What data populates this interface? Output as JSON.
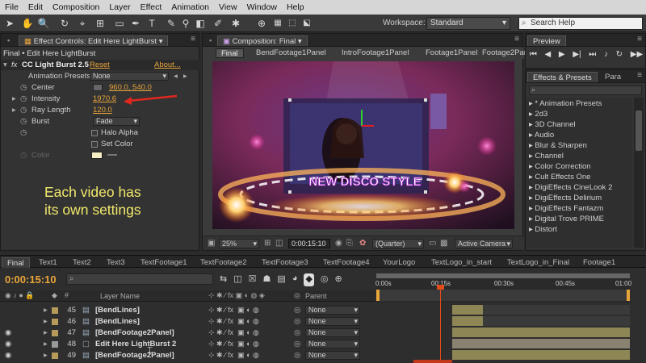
{
  "menu": [
    "File",
    "Edit",
    "Composition",
    "Layer",
    "Effect",
    "Animation",
    "View",
    "Window",
    "Help"
  ],
  "workspace": {
    "label": "Workspace:",
    "value": "Standard",
    "search_placeholder": "Search Help"
  },
  "effect_controls": {
    "tab_label": "Effect Controls: Edit Here LightBurst",
    "breadcrumb": "Final • Edit Here LightBurst",
    "effect_name": "CC Light Burst 2.5",
    "reset": "Reset",
    "about": "About...",
    "presets_label": "Animation Presets:",
    "presets_value": "None",
    "center_label": "Center",
    "center_value": "960.0, 540.0",
    "intensity_label": "Intensity",
    "intensity_value": "1970.6",
    "ray_label": "Ray Length",
    "ray_value": "120.0",
    "burst_label": "Burst",
    "burst_value": "Fade",
    "halo_label": "Halo Alpha",
    "setcolor_label": "Set Color",
    "color_label": "Color",
    "caption_line1": "Each video has",
    "caption_line2": "its own settings"
  },
  "composition": {
    "tab_label": "Composition: Final",
    "subtabs": [
      "Final",
      "BendFootage1Panel",
      "IntroFootage1Panel",
      "Footage1Panel",
      "Footage2Panel"
    ],
    "zoom": "25%",
    "timecode": "0:00:15:10",
    "quality": "(Quarter)",
    "camera": "Active Camera",
    "video_text": "NEW DISCO STYLE"
  },
  "preview": {
    "title": "Preview"
  },
  "effects_presets": {
    "title": "Effects & Presets",
    "second_tab": "Para",
    "items": [
      "* Animation Presets",
      "2d3",
      "3D Channel",
      "Audio",
      "Blur & Sharpen",
      "Channel",
      "Color Correction",
      "Cult Effects One",
      "DigiEffects CineLook 2",
      "DigiEffects Delirium",
      "DigiEffects Fantazm",
      "Digital Trove PRIME",
      "Distort"
    ]
  },
  "timeline": {
    "tabs": [
      "Final",
      "Text1",
      "Text2",
      "Text3",
      "TextFootage1",
      "TextFootage2",
      "TextFootage3",
      "TextFootage4",
      "YourLogo",
      "TextLogo_in_start",
      "TextLogo_in_Final",
      "Footage1"
    ],
    "timecode": "0:00:15:10",
    "layer_name_header": "Layer Name",
    "parent_header": "Parent",
    "ruler": [
      "0:00s",
      "00:15s",
      "00:30s",
      "00:45s",
      "01:00"
    ],
    "layers": [
      {
        "num": "45",
        "name": "[BendLines]",
        "parent": "None"
      },
      {
        "num": "46",
        "name": "[BendLines]",
        "parent": "None"
      },
      {
        "num": "47",
        "name": "[BendFootage2Panel]",
        "parent": "None"
      },
      {
        "num": "48",
        "name": "Edit Here LightBurst 2",
        "parent": "None"
      },
      {
        "num": "49",
        "name": "[BendFootage2Panel]",
        "parent": "None"
      }
    ]
  },
  "colors": {
    "accent_orange": "#e9a53b",
    "caption_yellow": "#f2e96b",
    "playhead": "#e24b1a",
    "bar_khaki": "#8f8655"
  }
}
